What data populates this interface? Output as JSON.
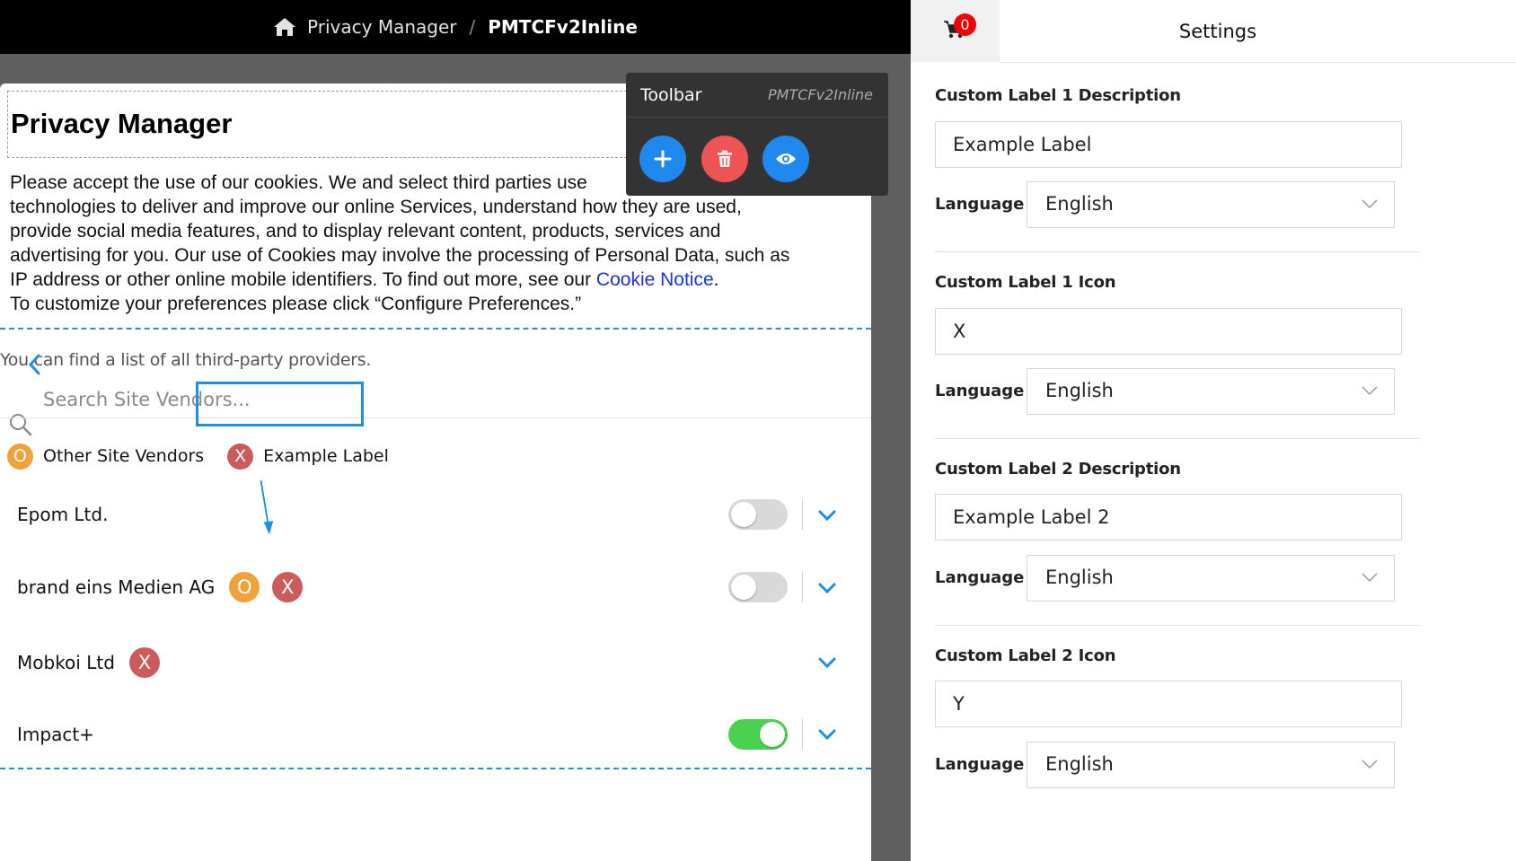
{
  "breadcrumb": {
    "home": "Privacy Manager",
    "separator": "/",
    "current": "PMTCFv2Inline"
  },
  "privacy_manager": {
    "title": "Privacy Manager",
    "body_line1": "Please accept the use of our cookies. We and select third parties use",
    "body_line2": "technologies to deliver and improve our online Services, understand how they are used,",
    "body_line3": "provide social media features, and to display relevant content, products, services and",
    "body_line4": "advertising for you. Our use of Cookies may involve the processing of Personal Data, such as",
    "body_line5_pre": "IP address or other online mobile identifiers. To find out more, see our ",
    "body_link": "Cookie Notice",
    "body_line5_post": ".",
    "body_line6": "To customize your preferences please click “Configure Preferences.”",
    "vendors_note": "You can find a list of all third-party providers.",
    "search_placeholder": "Search Site Vendors...",
    "filters": [
      {
        "icon": "O",
        "label": "Other Site Vendors",
        "color": "#f0a23a"
      },
      {
        "icon": "X",
        "label": "Example Label",
        "color": "#cc5c5c",
        "selected": true
      }
    ],
    "vendors": [
      {
        "name": "Epom Ltd.",
        "badges": [],
        "toggle": "off"
      },
      {
        "name": "brand eins Medien AG",
        "badges": [
          "O",
          "X"
        ],
        "toggle": "off"
      },
      {
        "name": "Mobkoi Ltd",
        "badges": [
          "X"
        ],
        "toggle": "none"
      },
      {
        "name": "Impact+",
        "badges": [],
        "toggle": "on"
      }
    ]
  },
  "toolbar": {
    "title": "Toolbar",
    "subtitle": "PMTCFv2Inline",
    "buttons": [
      "add-icon",
      "trash-icon",
      "eye-icon"
    ]
  },
  "settings": {
    "cart_badge": "0",
    "title": "Settings",
    "label1_desc_label": "Custom Label 1 Description",
    "label1_desc_value": "Example Label",
    "label1_icon_label": "Custom Label 1 Icon",
    "label1_icon_value": "X",
    "label2_desc_label": "Custom Label 2 Description",
    "label2_desc_value": "Example Label 2",
    "label2_icon_label": "Custom Label 2 Icon",
    "label2_icon_value": "Y",
    "language_label": "Language",
    "language_value": "English"
  },
  "colors": {
    "accent": "#1d8fe1",
    "toggle_on": "#4bd150",
    "danger": "#ee5454",
    "badge": "#f00000"
  }
}
